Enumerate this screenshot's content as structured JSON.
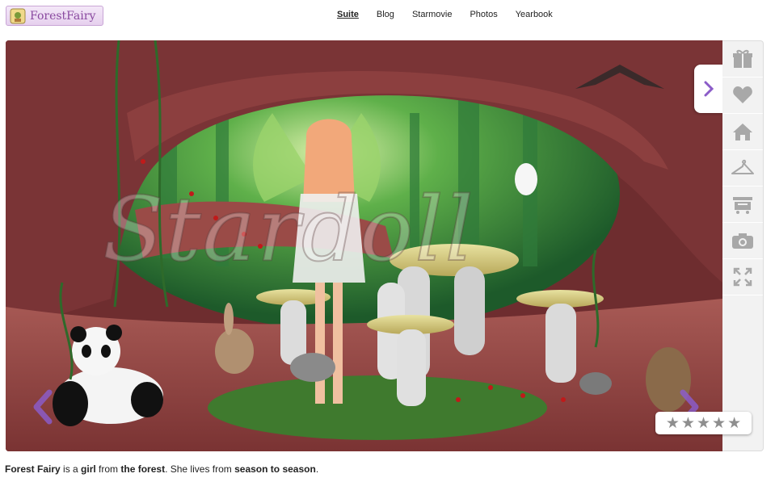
{
  "logo": {
    "text": "ForestFairy"
  },
  "nav": {
    "items": [
      "Suite",
      "Blog",
      "Starmovie",
      "Photos",
      "Yearbook"
    ],
    "active_index": 0
  },
  "watermark": {
    "text": "Stardoll"
  },
  "sidebar": {
    "icons": [
      "gift-icon",
      "heart-icon",
      "home-icon",
      "hanger-icon",
      "shop-icon",
      "camera-icon",
      "fullscreen-icon"
    ]
  },
  "rating": {
    "stars": 5,
    "filled": 0
  },
  "description": {
    "name": "Forest Fairy",
    "t1": " is a ",
    "b1": "girl",
    "t2": " from ",
    "b2": "the forest",
    "t3": ". She lives from ",
    "b3": "season to season",
    "t4": "."
  },
  "colors": {
    "accent": "#8a4aa0",
    "arrow": "#8b5cc8",
    "icon_gray": "#a8a8a8"
  }
}
